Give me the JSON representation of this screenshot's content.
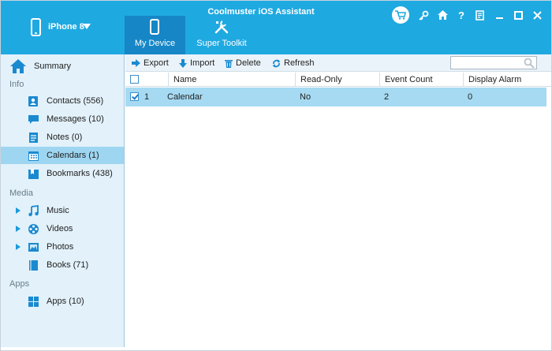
{
  "app": {
    "title": "Coolmuster iOS Assistant"
  },
  "device": {
    "name": "iPhone 8"
  },
  "nav_tabs": [
    {
      "label": "My Device",
      "active": true
    },
    {
      "label": "Super Toolkit",
      "active": false
    }
  ],
  "window_controls": [
    "cart-icon",
    "key-icon",
    "home-icon",
    "help-icon",
    "feedback-icon",
    "minimize-icon",
    "maximize-icon",
    "close-icon"
  ],
  "colors": {
    "titlebar": "#1fa9e1",
    "active_tab": "#1686c6",
    "sidebar": "#e2f1fa",
    "selected": "#9ed6f2"
  },
  "sidebar": {
    "summary_label": "Summary",
    "sections": {
      "info": "Info",
      "media": "Media",
      "apps": "Apps"
    },
    "info_items": [
      {
        "label": "Contacts  (556)",
        "icon": "contacts-icon"
      },
      {
        "label": "Messages  (10)",
        "icon": "messages-icon"
      },
      {
        "label": "Notes  (0)",
        "icon": "notes-icon"
      },
      {
        "label": "Calendars  (1)",
        "icon": "calendar-icon",
        "active": true
      },
      {
        "label": "Bookmarks  (438)",
        "icon": "bookmarks-icon"
      }
    ],
    "media_items": [
      {
        "label": "Music",
        "icon": "music-icon"
      },
      {
        "label": "Videos",
        "icon": "videos-icon"
      },
      {
        "label": "Photos",
        "icon": "photos-icon"
      },
      {
        "label": "Books  (71)",
        "icon": "books-icon"
      }
    ],
    "apps_items": [
      {
        "label": "Apps  (10)",
        "icon": "apps-icon"
      }
    ]
  },
  "toolbar": {
    "export_label": "Export",
    "import_label": "Import",
    "delete_label": "Delete",
    "refresh_label": "Refresh",
    "search_placeholder": ""
  },
  "table": {
    "columns": [
      "Name",
      "Read-Only",
      "Event Count",
      "Display Alarm"
    ],
    "rows": [
      {
        "index": "1",
        "name": "Calendar",
        "read_only": "No",
        "event_count": "2",
        "display_alarm": "0",
        "checked": true
      }
    ]
  }
}
